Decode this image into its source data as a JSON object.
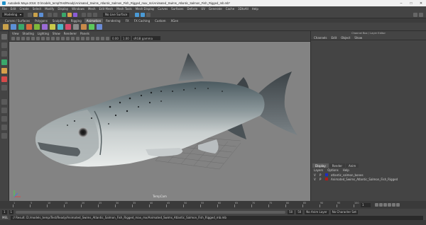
{
  "window": {
    "title": "Autodesk Maya 2016: D:\\models_temp\\Test\\Ready\\Animated_Swims_Atlantic_Salmon_Fish_Rigged_max_mx\\Animated_Swims_Atlantic_Salmon_Fish_Rigged_mb.mb*",
    "controls": [
      "–",
      "□",
      "✕"
    ]
  },
  "menubar": [
    "File",
    "Edit",
    "Create",
    "Select",
    "Modify",
    "Display",
    "Windows",
    "Mesh",
    "Edit Mesh",
    "Mesh Tools",
    "Mesh Display",
    "Curves",
    "Surfaces",
    "Deform",
    "UV",
    "Generate",
    "Cache",
    "3DtoAll",
    "Help"
  ],
  "statusline": {
    "mode": "Modeling",
    "live_surface": "No Live Surface",
    "account_icons": [
      "user-icon",
      "help-icon"
    ]
  },
  "shelf": {
    "tabs": [
      "Curves / Surfaces",
      "Polygons",
      "Sculpting",
      "Rigging",
      "Animation",
      "Rendering",
      "FX",
      "FX Caching",
      "Custom",
      "XGen"
    ],
    "active_tab": "Animation",
    "icon_colors": [
      "#c9a14a",
      "#5c8fd6",
      "#3aa86b",
      "#d96b3a",
      "#7fb83a",
      "#9a6bd6",
      "#c9c94a",
      "#4ab8c9",
      "#d64a6b",
      "#8a8a8a",
      "#c98a4a",
      "#5cc95c",
      "#6a8ad6"
    ]
  },
  "viewport": {
    "menu": [
      "View",
      "Shading",
      "Lighting",
      "Show",
      "Renderer",
      "Panels"
    ],
    "tool_values": [
      "0.00",
      "1.00"
    ],
    "color_space": "sRGB gamma",
    "camera_label": "TempCam"
  },
  "channel_box": {
    "header": "Channel Box / Layer Editor",
    "menu": [
      "Channels",
      "Edit",
      "Object",
      "Show"
    ]
  },
  "layer_editor": {
    "tabs": [
      "Display",
      "Render",
      "Anim"
    ],
    "active_tab": "Display",
    "menu": [
      "Layers",
      "Options",
      "Help"
    ],
    "layers": [
      {
        "v": "V",
        "p": "P",
        "color": "#1d2cc4",
        "name": "atlantic_salmon_bones"
      },
      {
        "v": "V",
        "p": "P",
        "color": "#b01a1a",
        "name": "Animated_Swims_Atlantic_Salmon_Fish_Rigged"
      }
    ]
  },
  "timeslider": {
    "ticks": [
      "1",
      "5",
      "10",
      "15",
      "20",
      "25",
      "30",
      "35",
      "40",
      "45",
      "50",
      "55",
      "60",
      "65",
      "70",
      "75",
      "80",
      "85",
      "90",
      "95",
      "100"
    ],
    "current_frame": "1"
  },
  "rangeslider": {
    "start": "1",
    "inner_start": "1",
    "inner_end": "50",
    "end": "50",
    "anim_layer": "No Anim Layer",
    "char_set": "No Character Set"
  },
  "commandline": {
    "label": "MEL",
    "result": "// Result: D:/models_temp/Test/Ready/Animated_Swims_Atlantic_Salmon_Fish_Rigged_max_mx/Animated_Swims_Atlantic_Salmon_Fish_Rigged_mb.mb"
  }
}
